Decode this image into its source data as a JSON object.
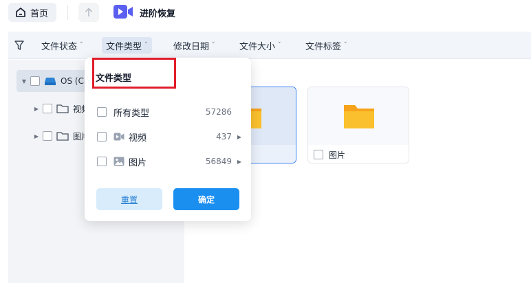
{
  "topbar": {
    "home_label": "首页",
    "app_title": "进阶恢复"
  },
  "filters": [
    {
      "label": "文件状态",
      "chevron": "˅"
    },
    {
      "label": "文件类型",
      "chevron": "˄"
    },
    {
      "label": "修改日期",
      "chevron": "˅"
    },
    {
      "label": "文件大小",
      "chevron": "˅"
    },
    {
      "label": "文件标签",
      "chevron": "˅"
    }
  ],
  "tree": {
    "drive_label": "OS (C:",
    "items": [
      {
        "label": "视频"
      },
      {
        "label": "图片"
      }
    ]
  },
  "cards": [
    {
      "label": ""
    },
    {
      "label": "图片"
    }
  ],
  "dropdown": {
    "title": "文件类型",
    "options": [
      {
        "label": "所有类型",
        "count": "57286"
      },
      {
        "label": "视频",
        "count": "437"
      },
      {
        "label": "图片",
        "count": "56849"
      }
    ],
    "reset_label": "重置",
    "ok_label": "确定"
  },
  "colors": {
    "accent": "#1b8ff0",
    "highlight": "#e11d2a",
    "folder": "#f7b924"
  }
}
